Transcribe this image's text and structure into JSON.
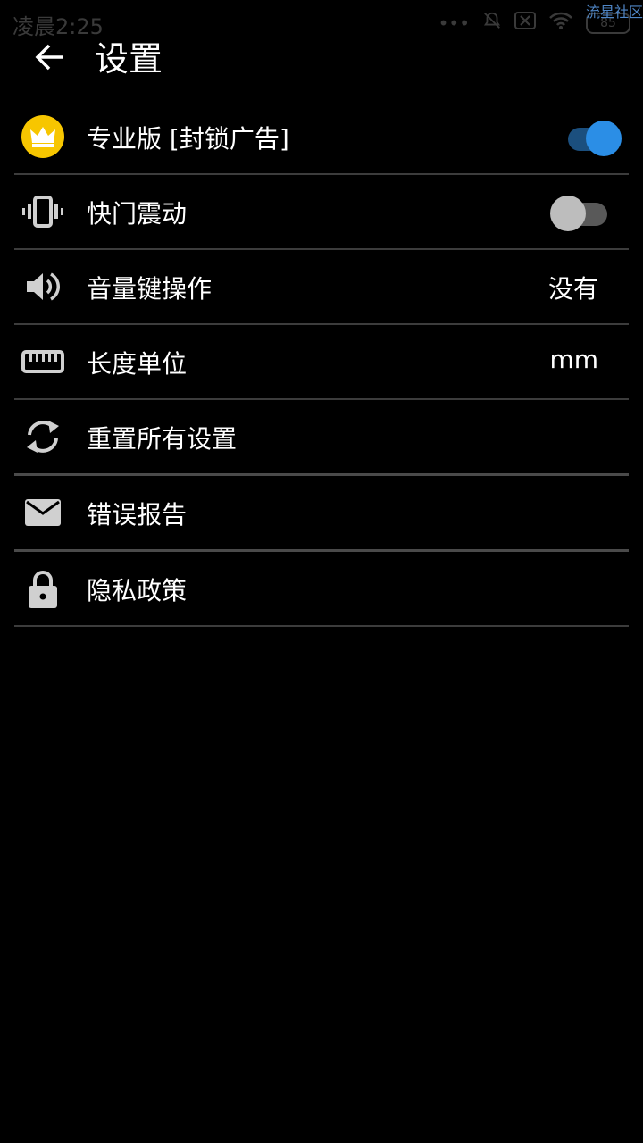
{
  "status": {
    "time": "凌晨2:25",
    "battery": "85",
    "watermark": "流星社区"
  },
  "header": {
    "title": "设置"
  },
  "items": [
    {
      "label": "专业版 [封锁广告]",
      "icon": "crown-icon",
      "control": "switch",
      "checked": true
    },
    {
      "label": "快门震动",
      "icon": "vibrate-icon",
      "control": "switch",
      "checked": false
    },
    {
      "label": "音量键操作",
      "icon": "volume-icon",
      "value": "没有"
    },
    {
      "label": "长度单位",
      "icon": "ruler-icon",
      "value": "mm"
    },
    {
      "label": "重置所有设置",
      "icon": "reset-icon"
    },
    {
      "label": "错误报告",
      "icon": "mail-icon"
    },
    {
      "label": "隐私政策",
      "icon": "lock-icon"
    }
  ],
  "colors": {
    "accent": "#2b8ee6",
    "crown_bg": "#f7c600",
    "divider": "#3c3c3c",
    "icon": "#d0d0d0"
  }
}
